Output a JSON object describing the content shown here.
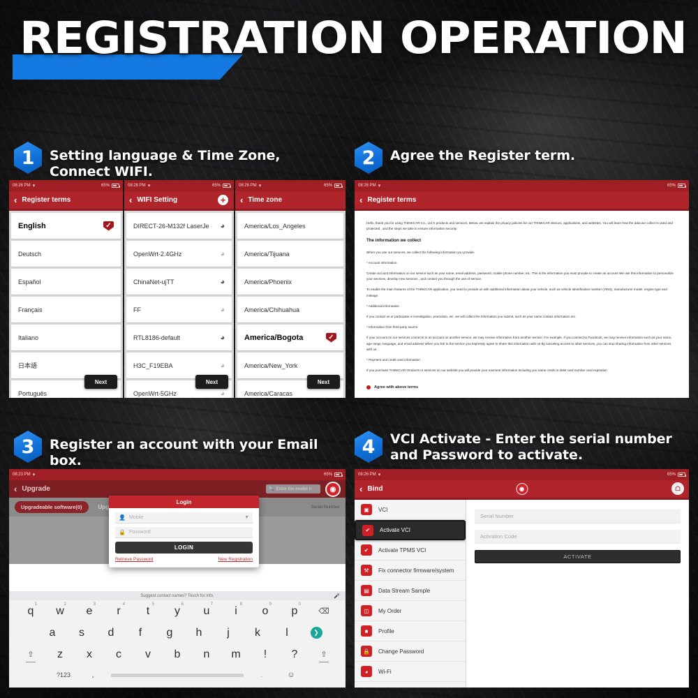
{
  "header": {
    "title": "REGISTRATION OPERATION",
    "accent_color": "#1479e0"
  },
  "theme": {
    "app_red": "#b0252b",
    "dark_red": "#8d1a20",
    "blue": "#1479e0",
    "check_red": "#a3161d"
  },
  "steps": [
    {
      "num": "1",
      "caption": "Setting language & Time Zone, Connect WIFI."
    },
    {
      "num": "2",
      "caption": "Agree the Register term."
    },
    {
      "num": "3",
      "caption": "Register an account with your Email box."
    },
    {
      "num": "4",
      "caption": "VCI Activate - Enter the serial number and Password to activate."
    }
  ],
  "status_bar": {
    "time": "08:26 PM",
    "time_alt": "08:23 PM",
    "battery": "65%",
    "wifi_icon": "wifi-icon"
  },
  "language_screen": {
    "title": "Register terms",
    "back_icon": "chevron-left-icon",
    "next_label": "Next",
    "items": [
      {
        "label": "English",
        "selected": true
      },
      {
        "label": "Deutsch",
        "selected": false
      },
      {
        "label": "Español",
        "selected": false
      },
      {
        "label": "Français",
        "selected": false
      },
      {
        "label": "Italiano",
        "selected": false
      },
      {
        "label": "日本語",
        "selected": false
      },
      {
        "label": "Português",
        "selected": false
      }
    ]
  },
  "wifi_screen": {
    "title": "WIFI Setting",
    "back_icon": "chevron-left-icon",
    "add_icon": "plus-icon",
    "next_label": "Next",
    "networks": [
      {
        "ssid": "DIRECT-26-M132f LaserJe",
        "signal": "strong"
      },
      {
        "ssid": "OpenWrt-2.4GHz",
        "signal": "weak"
      },
      {
        "ssid": "ChinaNet-ujTT",
        "signal": "strong"
      },
      {
        "ssid": "FF",
        "signal": "weak"
      },
      {
        "ssid": "RTL8186-default",
        "signal": "strong"
      },
      {
        "ssid": "H3C_F19EBA",
        "signal": "weak"
      },
      {
        "ssid": "OpenWrt-5GHz",
        "signal": "weak"
      }
    ]
  },
  "timezone_screen": {
    "title": "Time zone",
    "back_icon": "chevron-left-icon",
    "next_label": "Next",
    "zones": [
      {
        "label": "America/Los_Angeles",
        "selected": false
      },
      {
        "label": "America/Tijuana",
        "selected": false
      },
      {
        "label": "America/Phoenix",
        "selected": false
      },
      {
        "label": "America/Chihuahua",
        "selected": false
      },
      {
        "label": "America/Bogota",
        "selected": true
      },
      {
        "label": "America/New_York",
        "selected": false
      },
      {
        "label": "America/Caracas",
        "selected": false
      }
    ]
  },
  "terms_screen": {
    "title": "Register terms",
    "back_icon": "chevron-left-icon",
    "paragraphs": [
      {
        "type": "p",
        "text": "Hello, thank you for using THINKCAR Co., Ltd.'s products and services. Below, we explain the privacy policies for our THINKCAR devices, applications, and websites. You will learn how the data we collect is used and protected , and the steps we take to ensure information security."
      },
      {
        "type": "h",
        "text": "The information we collect"
      },
      {
        "type": "p",
        "text": "When you use our services, we collect the following information you provide."
      },
      {
        "type": "p",
        "text": "* Account information"
      },
      {
        "type": "p",
        "text": "Create account information on our service such as your name, email address, password, mobile phone number, etc. This is the information you must provide to create an account We use this information to personalize your services, develop new services , and contact you through the use of service."
      },
      {
        "type": "p",
        "text": "To enable the main features of the THINKCAR application, you need to provide us with additional information about your vehicle, such as vehicle identification number (VINS), manufacturer model, engine type and mileage."
      },
      {
        "type": "p",
        "text": "* Additional information"
      },
      {
        "type": "p",
        "text": "If you contact us or participate in investigation, promotion, etc. we will collect the information you submit, such as your name contact information etc."
      },
      {
        "type": "p",
        "text": "* Information from third party source"
      },
      {
        "type": "p",
        "text": "If your account on our services connects to an account on another service, we may receive information from another service. For example, If you connect to Facebook, we may receive information such as your name, age range, language, and email address When you link to the service you expressly agree to share this information with us By canceling access to other services, you can stop sharing information from other services with us."
      },
      {
        "type": "p",
        "text": "* Payment and credit card information"
      },
      {
        "type": "p",
        "text": "If you purchase THINKCAR Oroducts or services on our website you will provide your navment information including you name credit or debit card numher card expiration"
      }
    ],
    "agree_label": "Agree with above terms",
    "agree_checked": true
  },
  "upgrade_screen": {
    "title": "Upgrade",
    "back_icon": "chevron-left-icon",
    "search_placeholder": "Enter the model n",
    "search_icon": "search-icon",
    "camera_icon": "camera-icon",
    "pill_label": "Upgradeable software(0)",
    "tab_label": "Upg",
    "serial_label": "Serial Number"
  },
  "login_dialog": {
    "title": "Login",
    "account_placeholder": "Mobile",
    "account_icon": "user-icon",
    "dropdown_icon": "caret-down-icon",
    "password_placeholder": "Password",
    "password_icon": "lock-icon",
    "submit_label": "LOGIN",
    "retrieve_label": "Retrieve Password",
    "register_label": "New Registration"
  },
  "keyboard": {
    "suggest_text": "Suggest contact names? Touch for info.",
    "mic_icon": "microphone-icon",
    "row1": [
      {
        "key": "q",
        "alt": "1"
      },
      {
        "key": "w",
        "alt": "2"
      },
      {
        "key": "e",
        "alt": "3"
      },
      {
        "key": "r",
        "alt": "4"
      },
      {
        "key": "t",
        "alt": "5"
      },
      {
        "key": "y",
        "alt": "6"
      },
      {
        "key": "u",
        "alt": "7"
      },
      {
        "key": "i",
        "alt": "8"
      },
      {
        "key": "o",
        "alt": "9"
      },
      {
        "key": "p",
        "alt": "0"
      }
    ],
    "backspace_icon": "backspace-icon",
    "row2": [
      "a",
      "s",
      "d",
      "f",
      "g",
      "h",
      "j",
      "k",
      "l"
    ],
    "enter_icon": "enter-arrow-icon",
    "row3": [
      "z",
      "x",
      "c",
      "v",
      "b",
      "n",
      "m",
      "!",
      "?"
    ],
    "shift_icon": "shift-icon",
    "numeric_label": "?123",
    "comma_label": ",",
    "period_label": ".",
    "emoji_icon": "emoji-icon"
  },
  "bind_screen": {
    "title": "Bind",
    "back_icon": "chevron-left-icon",
    "camera_icon": "camera-icon",
    "home_icon": "home-icon",
    "menu": [
      {
        "label": "VCI",
        "icon": "device-icon",
        "active": false
      },
      {
        "label": "Activate VCI",
        "icon": "shield-check-icon",
        "active": true
      },
      {
        "label": "Activate TPMS VCI",
        "icon": "shield-check-icon",
        "active": false
      },
      {
        "label": "Fix connector firmware/system",
        "icon": "tools-icon",
        "active": false
      },
      {
        "label": "Data Stream Sample",
        "icon": "chart-icon",
        "active": false
      },
      {
        "label": "My Order",
        "icon": "clipboard-icon",
        "active": false
      },
      {
        "label": "Profile",
        "icon": "id-card-icon",
        "active": false
      },
      {
        "label": "Change Password",
        "icon": "lock-icon",
        "active": false
      },
      {
        "label": "Wi-Fi",
        "icon": "wifi-icon",
        "active": false
      }
    ],
    "serial_placeholder": "Serial Number",
    "activation_placeholder": "Activation Code",
    "activate_label": "ACTIVATE"
  }
}
